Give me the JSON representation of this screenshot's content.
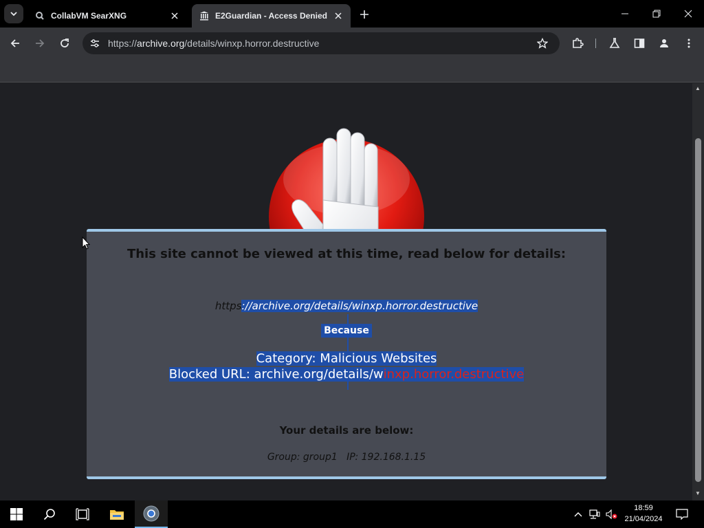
{
  "browser": {
    "tabs": [
      {
        "title": "CollabVM SearXNG",
        "active": false
      },
      {
        "title": "E2Guardian - Access Denied",
        "active": true
      }
    ],
    "url": {
      "scheme": "https://",
      "host": "archive.org",
      "path": "/details/winxp.horror.destructive"
    },
    "icons": {
      "tab_search": "chevron-down-icon",
      "new_tab": "plus-icon",
      "back": "back-arrow-icon",
      "forward": "forward-arrow-icon",
      "reload": "reload-icon",
      "site_info": "tune-icon",
      "bookmark": "star-icon",
      "extensions": "puzzle-icon",
      "labs": "flask-icon",
      "side_panel": "side-panel-icon",
      "profile": "profile-icon",
      "menu": "kebab-menu-icon"
    }
  },
  "block_page": {
    "heading": "This site cannot be viewed at this time, read below for details:",
    "blocked_url_prefix": "https",
    "blocked_url_rest": "://archive.org/details/winxp.horror.destructive",
    "because": "Because",
    "category": "Category: Malicious Websites",
    "blocked_url_label_part": "Blocked URL: archive.org/details/w",
    "blocked_url_red_part": "inxp.horror.destructive",
    "details_heading": "Your details are below:",
    "group": "Group: group1",
    "ip": "IP: 192.168.1.15"
  },
  "taskbar": {
    "time": "18:59",
    "date": "21/04/2024",
    "icons": [
      "windows-start-icon",
      "search-icon",
      "task-view-icon",
      "file-explorer-icon",
      "chrome-icon"
    ]
  },
  "colors": {
    "selection": "#1f4ea8",
    "blocked_red": "#d9231b",
    "box_border": "#9fc8e8",
    "box_bg": "#474a53"
  }
}
